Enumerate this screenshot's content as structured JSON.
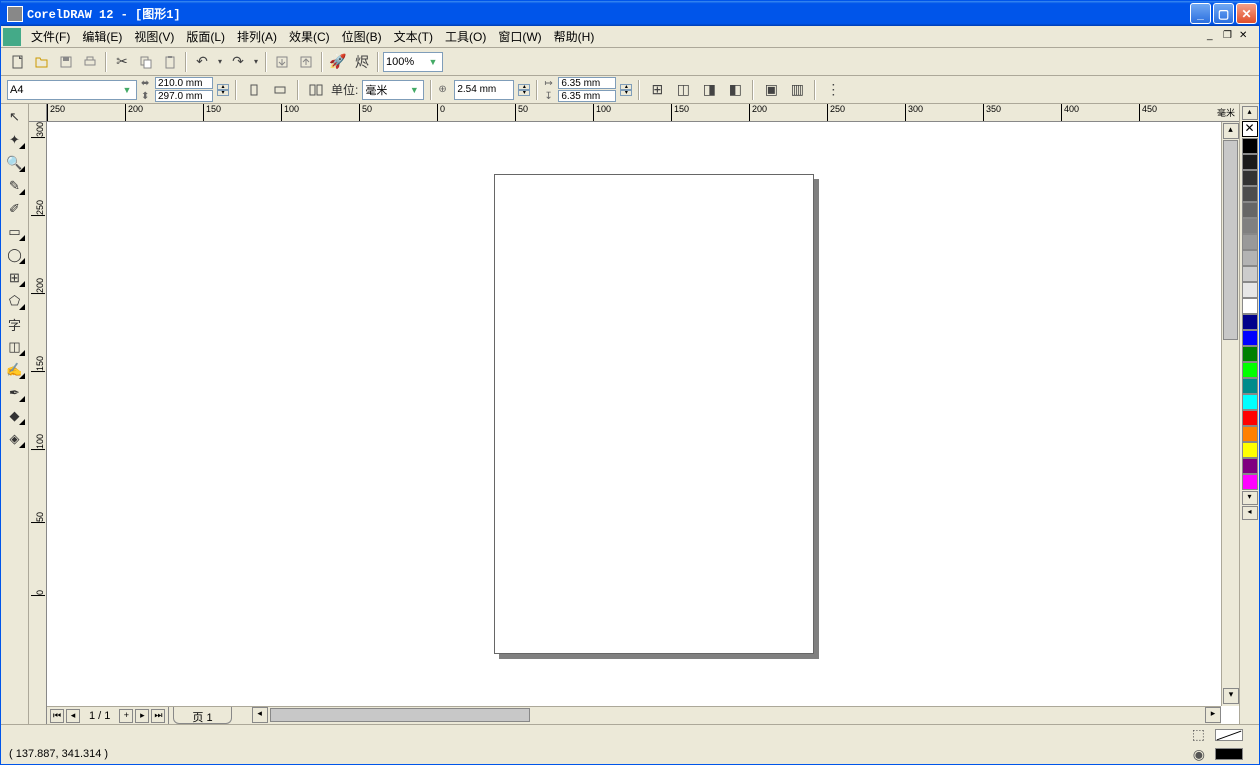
{
  "title": "CorelDRAW 12 - [图形1]",
  "menu": {
    "file": "文件(F)",
    "edit": "编辑(E)",
    "view": "视图(V)",
    "layout": "版面(L)",
    "arrange": "排列(A)",
    "effects": "效果(C)",
    "bitmaps": "位图(B)",
    "text": "文本(T)",
    "tools": "工具(O)",
    "window": "窗口(W)",
    "help": "帮助(H)"
  },
  "toolbar": {
    "zoom": "100%"
  },
  "propbar": {
    "paper_size": "A4",
    "width": "210.0 mm",
    "height": "297.0 mm",
    "unit_label": "单位:",
    "unit": "毫米",
    "nudge": "2.54 mm",
    "dup_x": "6.35 mm",
    "dup_y": "6.35 mm"
  },
  "ruler": {
    "unit": "毫米",
    "ticks_h": [
      "250",
      "200",
      "150",
      "100",
      "50",
      "0",
      "50",
      "100",
      "150",
      "200",
      "250",
      "300",
      "350",
      "400",
      "450"
    ],
    "ticks_v": [
      "300",
      "250",
      "200",
      "150",
      "100",
      "50",
      "0"
    ]
  },
  "page_nav": {
    "count": "1 / 1",
    "tab": "页 1"
  },
  "status": {
    "coords": "( 137.887, 341.314 )"
  },
  "palette": [
    "#000000",
    "#1a1a1a",
    "#333333",
    "#4d4d4d",
    "#666666",
    "#808080",
    "#999999",
    "#b3b3b3",
    "#cccccc",
    "#e6e6e6",
    "#ffffff",
    "#00008b",
    "#0000ff",
    "#008000",
    "#00ff00",
    "#008b8b",
    "#00ffff",
    "#ff0000",
    "#ff8000",
    "#ffff00",
    "#800080",
    "#ff00ff"
  ]
}
